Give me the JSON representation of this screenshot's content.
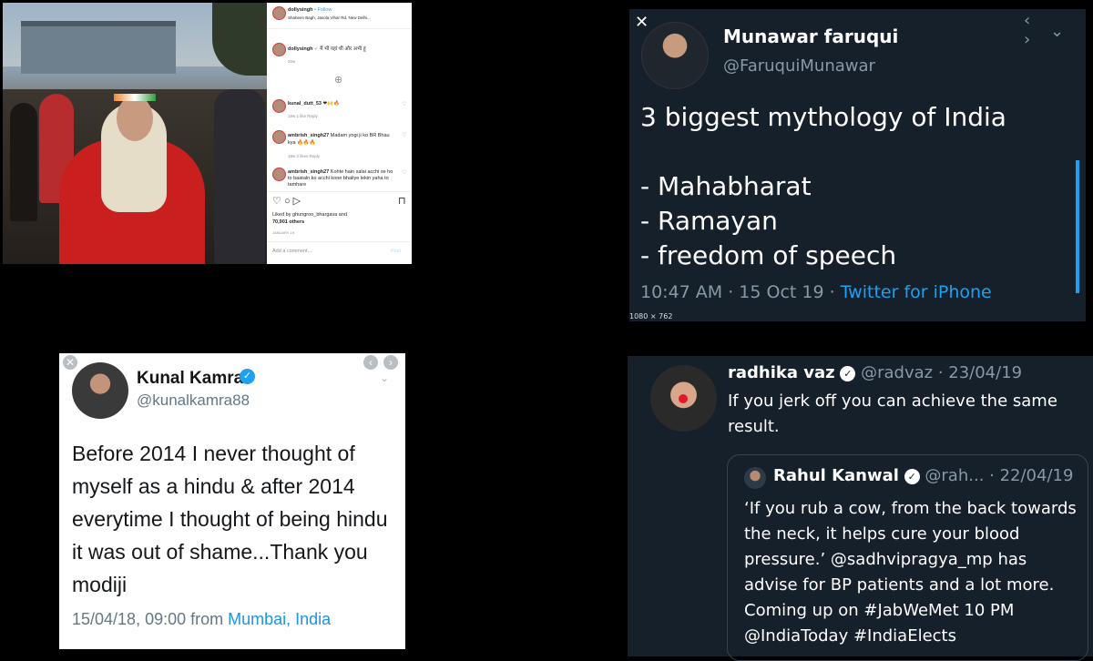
{
  "instagram": {
    "username": "dollysingh",
    "follow": "Follow",
    "location": "Shaheen Bagh, Jasola Vihar Rd, New Delhi...",
    "caption_user": "dollysingh",
    "caption": "मैं भी यहां थी और अभी हूं",
    "caption_time": "20w",
    "comments": [
      {
        "user": "kunal_dutt_53",
        "text": "❤🙌🔥",
        "meta": "19w  1 like  Reply"
      },
      {
        "user": "ambrish_singh27",
        "text": "Madam yogi ji ko BR Bhau kya 🔥🔥🔥",
        "meta": "19w  2 likes  Reply"
      },
      {
        "user": "ambrish_singh27",
        "text": "Kohte hain salai acchi se ho to baataln ko acchi kone bhaliye lekin yaha to tamhare",
        "meta": ""
      }
    ],
    "liked_by": "Liked by ghungroo_bhargava and",
    "others": "70,901 others",
    "date": "JANUARY 19",
    "add_comment": "Add a comment...",
    "post": "Post"
  },
  "tweet_munawar": {
    "close": "✕",
    "nav": "‹ ›",
    "chevron": "⌄",
    "name": "Munawar faruqui",
    "handle": "@FaruquiMunawar",
    "line1": "3 biggest mythology of India",
    "line2": "- Mahabharat",
    "line3": "- Ramayan",
    "line4": "- freedom of speech",
    "time": "10:47 AM · 15 Oct 19 · ",
    "source": "Twitter for iPhone",
    "dimensions": "1080 × 762"
  },
  "tweet_kunal": {
    "close": "✕",
    "prev": "‹",
    "next": "›",
    "chevron": "⌄",
    "name": "Kunal Kamra",
    "check": "✓",
    "handle": "@kunalkamra88",
    "text": "Before 2014 I never thought of myself as a hindu & after 2014 everytime I thought of being hindu it was out of shame...Thank you modiji",
    "meta_prefix": "15/04/18, 09:00 from ",
    "location": "Mumbai, India"
  },
  "tweet_radhika": {
    "name": "radhika vaz",
    "check": "✓",
    "handle_date": "@radvaz · 23/04/19",
    "text": "If you jerk off you can achieve the same result.",
    "quote_name": "Rahul Kanwal",
    "quote_handle_date": "@rah... · 22/04/19",
    "quote_text": "‘If you rub a cow, from the back towards the neck, it helps cure your blood pressure.’ @sadhvipragya_mp has advise for BP patients and a lot more. Coming up on #JabWeMet 10 PM @IndiaToday #IndiaElects"
  }
}
